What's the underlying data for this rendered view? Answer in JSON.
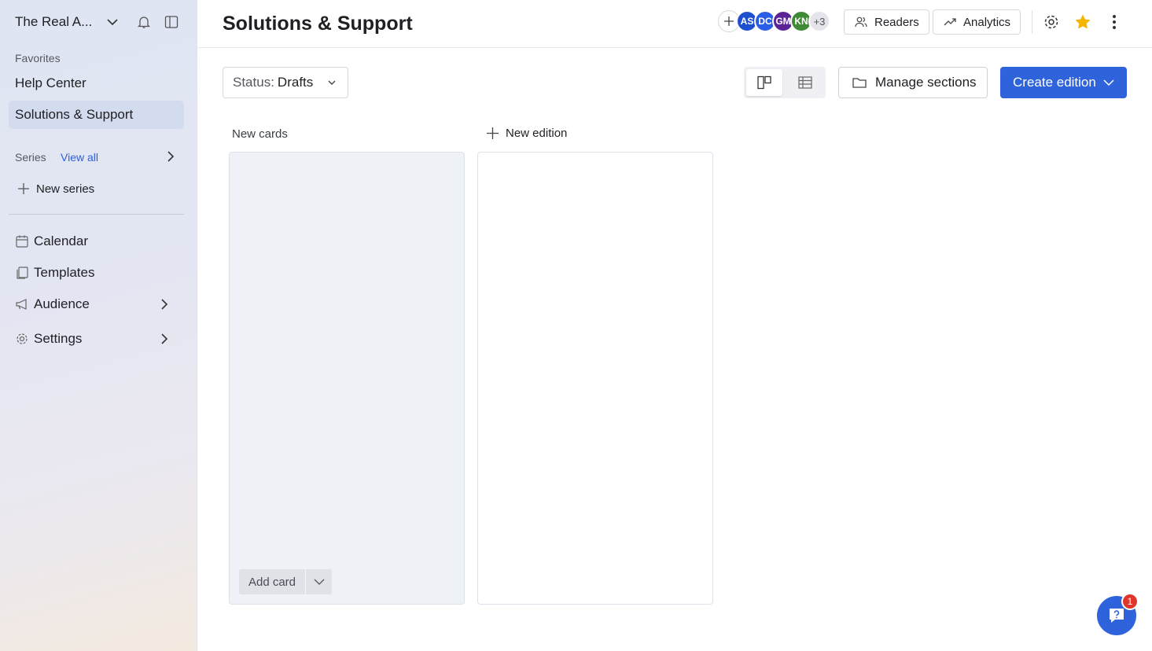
{
  "sidebar": {
    "workspace_name": "The Real A...",
    "favorites_label": "Favorites",
    "favorites": [
      {
        "label": "Help Center"
      },
      {
        "label": "Solutions & Support"
      }
    ],
    "series_label": "Series",
    "series_view_all": "View all",
    "new_series": "New series",
    "nav": [
      {
        "label": "Calendar",
        "icon": "calendar-icon"
      },
      {
        "label": "Templates",
        "icon": "templates-icon"
      },
      {
        "label": "Audience",
        "icon": "megaphone-icon"
      },
      {
        "label": "Settings",
        "icon": "gear-icon"
      }
    ]
  },
  "header": {
    "title": "Solutions & Support",
    "avatars": [
      {
        "initials": "AS",
        "color": "#1f4fd1"
      },
      {
        "initials": "DC",
        "color": "#2a5ee6"
      },
      {
        "initials": "GM",
        "color": "#5a2497"
      },
      {
        "initials": "KN",
        "color": "#3f8a35"
      }
    ],
    "more_count": "+3",
    "readers_label": "Readers",
    "analytics_label": "Analytics"
  },
  "toolbar": {
    "status_key": "Status:",
    "status_value": "Drafts",
    "manage_sections": "Manage sections",
    "create_edition": "Create edition"
  },
  "board": {
    "column_title": "New cards",
    "new_edition": "New edition",
    "add_card": "Add card"
  },
  "help": {
    "badge_count": "1"
  },
  "colors": {
    "accent": "#2e63dc",
    "star": "#f5b400",
    "badge": "#e0352b"
  }
}
